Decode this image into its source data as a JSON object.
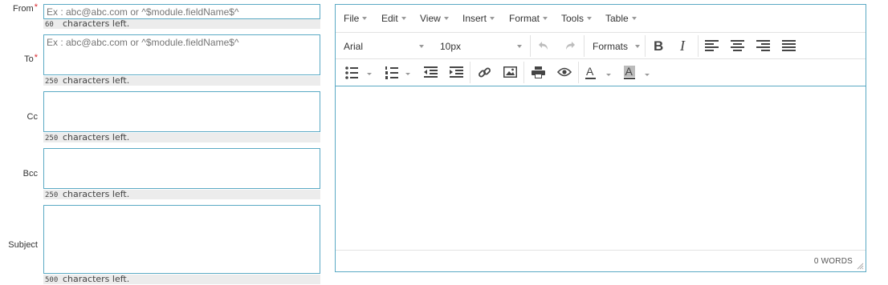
{
  "form": {
    "from": {
      "label": "From",
      "required_mark": "*",
      "placeholder": "Ex : abc@abc.com or ^$module.fieldName$^",
      "counter_num": "60",
      "counter_text": "characters left."
    },
    "to": {
      "label": "To",
      "required_mark": "*",
      "placeholder": "Ex : abc@abc.com or ^$module.fieldName$^",
      "counter_num": "250",
      "counter_text": "characters left."
    },
    "cc": {
      "label": "Cc",
      "placeholder": "",
      "counter_num": "250",
      "counter_text": "characters left."
    },
    "bcc": {
      "label": "Bcc",
      "placeholder": "",
      "counter_num": "250",
      "counter_text": "characters left."
    },
    "subject": {
      "label": "Subject",
      "placeholder": "",
      "counter_num": "500",
      "counter_text": "characters left."
    }
  },
  "editor": {
    "menu": {
      "file": "File",
      "edit": "Edit",
      "view": "View",
      "insert": "Insert",
      "format": "Format",
      "tools": "Tools",
      "table": "Table"
    },
    "toolbar": {
      "font_family": "Arial",
      "font_size": "10px",
      "formats": "Formats",
      "icons_row1": [
        "undo-icon",
        "redo-icon",
        "bold-icon",
        "italic-icon",
        "align-left-icon",
        "align-center-icon",
        "align-right-icon",
        "align-justify-icon"
      ],
      "icons_row2": [
        "bullet-list-icon",
        "numbered-list-icon",
        "outdent-icon",
        "indent-icon",
        "link-icon",
        "image-icon",
        "print-icon",
        "preview-icon",
        "text-color-icon",
        "background-color-icon"
      ]
    },
    "status": {
      "word_count": "0 WORDS"
    },
    "colors": {
      "border": "#5aa9c4",
      "separator": "#e2e2e2",
      "required": "#d9242b"
    }
  }
}
